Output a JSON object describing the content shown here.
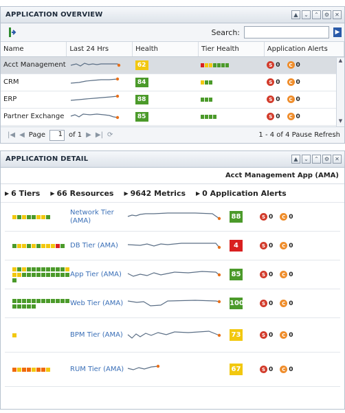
{
  "overview": {
    "title": "APPLICATION OVERVIEW",
    "search_label": "Search:",
    "search_value": "",
    "columns": [
      "Name",
      "Last 24 Hrs",
      "Health",
      "Tier Health",
      "Application Alerts"
    ],
    "rows": [
      {
        "name": "Acct Management A",
        "health": "62",
        "health_color": "#f2c80f",
        "tier_colors": [
          "#d92020",
          "#f2c80f",
          "#f2c80f",
          "#4b9a2a",
          "#4b9a2a",
          "#4b9a2a",
          "#4b9a2a"
        ],
        "s_count": "0",
        "c_count": "0"
      },
      {
        "name": "CRM",
        "health": "84",
        "health_color": "#4b9a2a",
        "tier_colors": [
          "#f2c80f",
          "#4b9a2a",
          "#4b9a2a"
        ],
        "s_count": "0",
        "c_count": "0"
      },
      {
        "name": "ERP",
        "health": "88",
        "health_color": "#4b9a2a",
        "tier_colors": [
          "#4b9a2a",
          "#4b9a2a",
          "#4b9a2a"
        ],
        "s_count": "0",
        "c_count": "0"
      },
      {
        "name": "Partner Exchange",
        "health": "85",
        "health_color": "#4b9a2a",
        "tier_colors": [
          "#4b9a2a",
          "#4b9a2a",
          "#4b9a2a",
          "#4b9a2a"
        ],
        "s_count": "0",
        "c_count": "0"
      }
    ],
    "pager": {
      "page_label": "Page",
      "page_value": "1",
      "of_label": "of 1",
      "status": "1 - 4 of 4  Pause Refresh"
    }
  },
  "detail": {
    "title": "APPLICATION DETAIL",
    "app_name": "Acct Management App (AMA)",
    "summary": [
      "6 Tiers",
      "66 Resources",
      "9642 Metrics",
      "0 Application Alerts"
    ],
    "tiers": [
      {
        "name": "Network Tier (AMA)",
        "health": "88",
        "health_color": "#4b9a2a",
        "dots": [
          "#f2c80f",
          "#4b9a2a",
          "#f2c80f",
          "#4b9a2a",
          "#4b9a2a",
          "#f2c80f",
          "#f2c80f",
          "#4b9a2a"
        ],
        "s_count": "0",
        "c_count": "0"
      },
      {
        "name": "DB Tier (AMA)",
        "health": "4",
        "health_color": "#d92020",
        "dots": [
          "#4b9a2a",
          "#f2c80f",
          "#f2c80f",
          "#4b9a2a",
          "#f2c80f",
          "#4b9a2a",
          "#f2c80f",
          "#f2c80f",
          "#f2c80f",
          "#d92020",
          "#4b9a2a"
        ],
        "s_count": "0",
        "c_count": "0"
      },
      {
        "name": "App Tier (AMA)",
        "health": "85",
        "health_color": "#4b9a2a",
        "dots": [
          "#f2c80f",
          "#4b9a2a",
          "#f2c80f",
          "#4b9a2a",
          "#4b9a2a",
          "#4b9a2a",
          "#4b9a2a",
          "#4b9a2a",
          "#4b9a2a",
          "#4b9a2a",
          "#4b9a2a",
          "#f2c80f",
          "#f2c80f",
          "#f2c80f",
          "#4b9a2a",
          "#4b9a2a",
          "#4b9a2a",
          "#4b9a2a",
          "#4b9a2a",
          "#4b9a2a",
          "#4b9a2a",
          "#4b9a2a",
          "#4b9a2a",
          "#4b9a2a",
          "#4b9a2a"
        ],
        "s_count": "0",
        "c_count": "0"
      },
      {
        "name": "Web Tier (AMA)",
        "health": "100",
        "health_color": "#4b9a2a",
        "dots": [
          "#4b9a2a",
          "#4b9a2a",
          "#4b9a2a",
          "#4b9a2a",
          "#4b9a2a",
          "#4b9a2a",
          "#4b9a2a",
          "#4b9a2a",
          "#4b9a2a",
          "#4b9a2a",
          "#4b9a2a",
          "#4b9a2a",
          "#4b9a2a",
          "#4b9a2a",
          "#4b9a2a",
          "#4b9a2a",
          "#4b9a2a"
        ],
        "s_count": "0",
        "c_count": "0"
      },
      {
        "name": "BPM Tier (AMA)",
        "health": "73",
        "health_color": "#f2c80f",
        "dots": [
          "#f2c80f"
        ],
        "s_count": "0",
        "c_count": "0"
      },
      {
        "name": "RUM Tier (AMA)",
        "health": "67",
        "health_color": "#f2c80f",
        "dots": [
          "#f06a0a",
          "#f2c80f",
          "#f06a0a",
          "#f06a0a",
          "#f2c80f",
          "#f06a0a",
          "#f06a0a",
          "#f2c80f"
        ],
        "s_count": "0",
        "c_count": "0"
      }
    ]
  },
  "colors": {
    "orange": "#e8701a",
    "spark": "#5a6e85",
    "green": "#4b9a2a",
    "yellow": "#f2c80f",
    "red": "#d92020"
  }
}
